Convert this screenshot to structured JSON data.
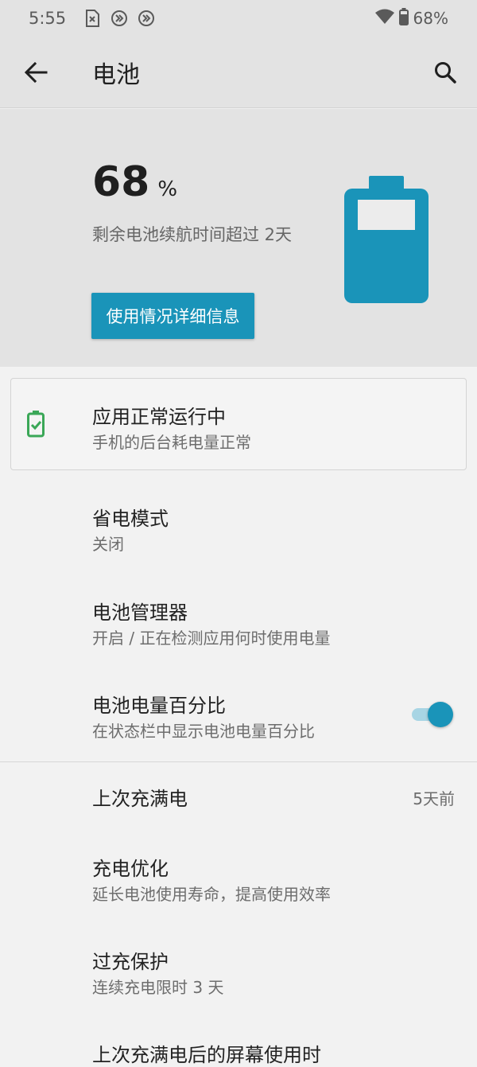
{
  "status_bar": {
    "time": "5:55",
    "battery_text": "68%",
    "icons": [
      "sim-card-off-icon",
      "data-saver-icon",
      "data-saver-icon",
      "wifi-icon",
      "battery-icon"
    ]
  },
  "app_bar": {
    "title": "电池",
    "back_icon": "arrow-back-icon",
    "search_icon": "search-icon"
  },
  "hero": {
    "percent": "68",
    "percent_unit": "%",
    "remaining": "剩余电池续航时间超过 2天",
    "details_button": "使用情况详细信息",
    "battery_level": 0.68
  },
  "tip_card": {
    "title": "应用正常运行中",
    "subtitle": "手机的后台耗电量正常"
  },
  "settings": {
    "power_saver": {
      "title": "省电模式",
      "subtitle": "关闭"
    },
    "battery_manager": {
      "title": "电池管理器",
      "subtitle": "开启 / 正在检测应用何时使用电量"
    },
    "battery_percentage": {
      "title": "电池电量百分比",
      "subtitle": "在状态栏中显示电池电量百分比",
      "enabled": true
    },
    "last_full_charge": {
      "title": "上次充满电",
      "value": "5天前"
    },
    "charge_optimization": {
      "title": "充电优化",
      "subtitle": "延长电池使用寿命，提高使用效率"
    },
    "overcharge_protection": {
      "title": "过充保护",
      "subtitle": "连续充电限时 3 天"
    },
    "screen_usage": {
      "title": "上次充满电后的屏幕使用时"
    }
  },
  "colors": {
    "accent": "#1a94b9",
    "header_bg": "#e3e3e3",
    "page_bg": "#f2f2f2",
    "ok_green": "#3aa757"
  }
}
